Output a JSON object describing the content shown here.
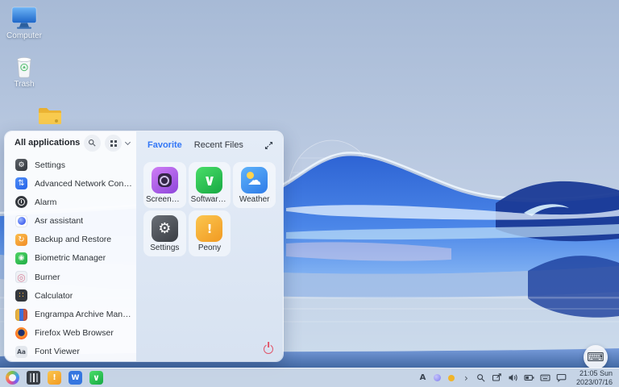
{
  "desktop": {
    "icons": [
      {
        "label": "Computer",
        "icon": "computer-icon"
      },
      {
        "label": "Trash",
        "icon": "trash-icon"
      },
      {
        "label": "",
        "icon": "folder-icon"
      }
    ]
  },
  "start_menu": {
    "title": "All applications",
    "header_icons": [
      "search-icon",
      "grid-view-icon",
      "chevron-down-icon"
    ],
    "tabs": [
      {
        "label": "Favorite",
        "active": true
      },
      {
        "label": "Recent Files",
        "active": false
      }
    ],
    "apps": [
      {
        "name": "Settings",
        "icon": "settings-icon",
        "glyph": "⚙"
      },
      {
        "name": "Advanced Network Configura...",
        "icon": "network-config-icon",
        "glyph": "⇅"
      },
      {
        "name": "Alarm",
        "icon": "alarm-icon",
        "glyph": ""
      },
      {
        "name": "Asr assistant",
        "icon": "asr-assistant-icon",
        "glyph": ""
      },
      {
        "name": "Backup and Restore",
        "icon": "backup-restore-icon",
        "glyph": "↻"
      },
      {
        "name": "Biometric Manager",
        "icon": "biometric-icon",
        "glyph": "◉"
      },
      {
        "name": "Burner",
        "icon": "disc-burner-icon",
        "glyph": "◎"
      },
      {
        "name": "Calculator",
        "icon": "calculator-icon",
        "glyph": "∷"
      },
      {
        "name": "Engrampa Archive Manager",
        "icon": "archive-manager-icon",
        "glyph": ""
      },
      {
        "name": "Firefox Web Browser",
        "icon": "firefox-icon",
        "glyph": ""
      },
      {
        "name": "Font Viewer",
        "icon": "font-viewer-icon",
        "glyph": "Aa"
      }
    ],
    "favorites": [
      {
        "name": "Screenshot",
        "icon": "screenshot-icon",
        "glyph": ""
      },
      {
        "name": "Software S...",
        "icon": "software-store-icon",
        "glyph": "∨"
      },
      {
        "name": "Weather",
        "icon": "weather-icon",
        "glyph": "☁"
      },
      {
        "name": "Settings",
        "icon": "settings-icon",
        "glyph": "⚙"
      },
      {
        "name": "Peony",
        "icon": "peony-files-icon",
        "glyph": "!"
      }
    ],
    "expand_icon": "expand-icon",
    "power_icon": "power-icon",
    "colors": {
      "accent": "#3377f6",
      "power": "#e0556a"
    }
  },
  "taskbar": {
    "pinned": [
      {
        "icon": "start-menu-logo",
        "glyph": ""
      },
      {
        "icon": "task-view-icon",
        "glyph": ""
      },
      {
        "icon": "peony-files-icon",
        "glyph": "!"
      },
      {
        "icon": "wps-office-icon",
        "glyph": "W"
      },
      {
        "icon": "software-store-icon",
        "glyph": "∨"
      }
    ],
    "tray": [
      {
        "icon": "input-method-icon",
        "glyph": "A"
      },
      {
        "icon": "tray-app-purple-icon",
        "glyph": ""
      },
      {
        "icon": "tray-app-yellow-icon",
        "glyph": ""
      },
      {
        "icon": "tray-expand-icon",
        "glyph": "›"
      },
      {
        "icon": "search-icon",
        "glyph": ""
      },
      {
        "icon": "project-screen-icon",
        "glyph": ""
      },
      {
        "icon": "volume-icon",
        "glyph": ""
      },
      {
        "icon": "battery-icon",
        "glyph": ""
      },
      {
        "icon": "keyboard-tray-icon",
        "glyph": ""
      },
      {
        "icon": "notification-icon",
        "glyph": ""
      }
    ],
    "clock": {
      "time": "21:05 Sun",
      "date": "2023/07/16"
    },
    "color": "#c6d3e5"
  },
  "keyboard_button": {
    "icon": "virtual-keyboard-icon",
    "glyph": "⌨"
  }
}
